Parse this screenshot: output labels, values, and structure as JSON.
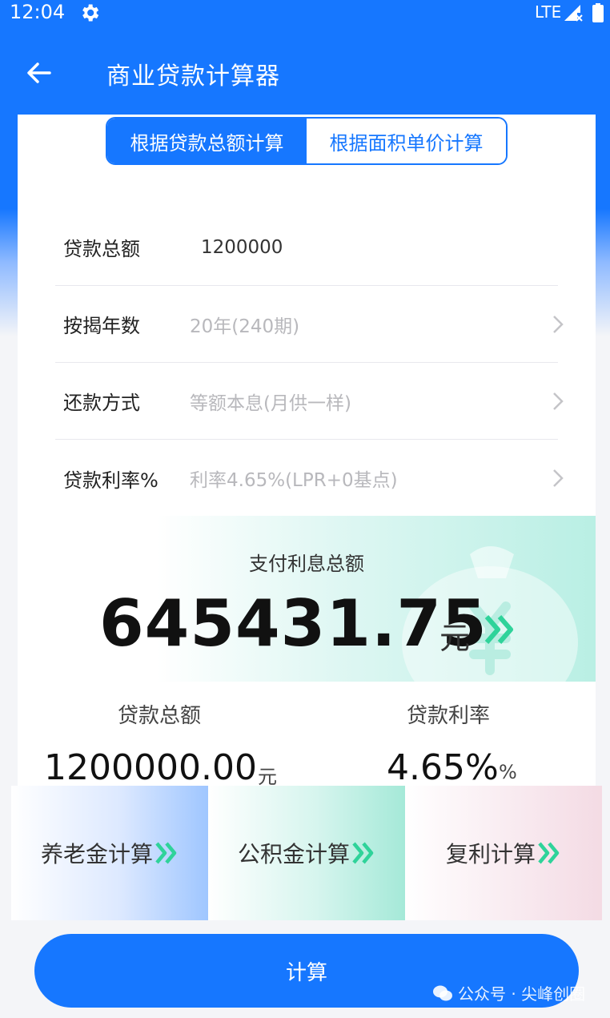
{
  "status_bar": {
    "time": "12:04",
    "network": "LTE"
  },
  "toolbar": {
    "title": "商业贷款计算器"
  },
  "segment": {
    "tabs": [
      {
        "label": "根据贷款总额计算",
        "selected": true
      },
      {
        "label": "根据面积单价计算",
        "selected": false
      }
    ]
  },
  "form": {
    "rows": [
      {
        "label": "贷款总额",
        "value": "1200000"
      },
      {
        "label": "按揭年数",
        "value": "20年(240期)"
      },
      {
        "label": "还款方式",
        "value": "等额本息(月供一样)"
      },
      {
        "label": "贷款利率%",
        "value": "利率4.65%(LPR+0基点)"
      }
    ]
  },
  "result": {
    "label": "支付利息总额",
    "amount": "645431.75",
    "unit": "元"
  },
  "summary": {
    "loan_label": "贷款总额",
    "loan_value": "1200000.00",
    "loan_unit": "元",
    "rate_label": "贷款利率",
    "rate_value": "4.65%",
    "rate_unit": "%"
  },
  "quick_links": [
    {
      "label": "养老金计算"
    },
    {
      "label": "公积金计算"
    },
    {
      "label": "复利计算"
    }
  ],
  "calc_button": {
    "label": "计算"
  },
  "watermark": {
    "text": "公众号 · 尖峰创圈"
  },
  "colors": {
    "primary": "#1677ff",
    "accent_green": "#2fd39a"
  }
}
